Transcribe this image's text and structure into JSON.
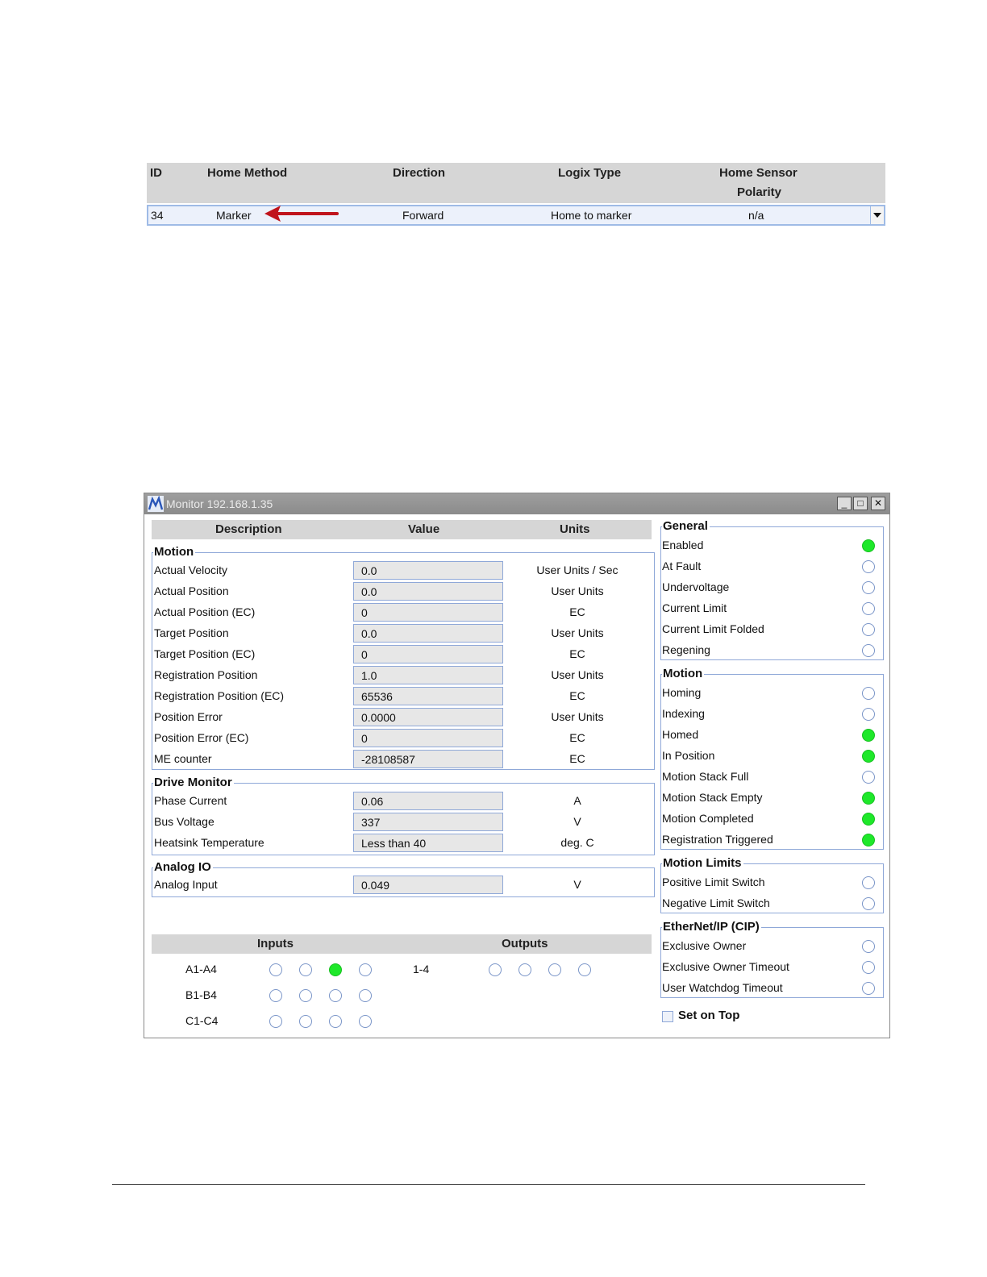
{
  "home_table": {
    "headers": {
      "id": "ID",
      "method": "Home Method",
      "direction": "Direction",
      "logix": "Logix Type",
      "sensor_line1": "Home Sensor",
      "sensor_line2": "Polarity"
    },
    "row": {
      "id": "34",
      "method": "Marker",
      "direction": "Forward",
      "logix": "Home to marker",
      "sensor": "n/a"
    }
  },
  "monitor": {
    "title": "Monitor  192.168.1.35",
    "window_buttons": {
      "minimize": "_",
      "maximize": "□",
      "close": "✕"
    },
    "columns": {
      "description": "Description",
      "value": "Value",
      "units": "Units"
    },
    "motion_group": "Motion",
    "motion_rows": [
      {
        "desc": "Actual Velocity",
        "value": "0.0",
        "unit": "User Units / Sec"
      },
      {
        "desc": "Actual Position",
        "value": "0.0",
        "unit": "User Units"
      },
      {
        "desc": "Actual Position (EC)",
        "value": "0",
        "unit": "EC"
      },
      {
        "desc": "Target Position",
        "value": "0.0",
        "unit": "User Units"
      },
      {
        "desc": "Target Position (EC)",
        "value": "0",
        "unit": "EC"
      },
      {
        "desc": "Registration Position",
        "value": "1.0",
        "unit": "User Units"
      },
      {
        "desc": "Registration Position (EC)",
        "value": "65536",
        "unit": "EC"
      },
      {
        "desc": "Position Error",
        "value": "0.0000",
        "unit": "User Units"
      },
      {
        "desc": "Position Error (EC)",
        "value": "0",
        "unit": "EC"
      },
      {
        "desc": "ME counter",
        "value": "-28108587",
        "unit": "EC"
      }
    ],
    "drive_group": "Drive Monitor",
    "drive_rows": [
      {
        "desc": "Phase Current",
        "value": "0.06",
        "unit": "A"
      },
      {
        "desc": "Bus Voltage",
        "value": "337",
        "unit": "V"
      },
      {
        "desc": "Heatsink Temperature",
        "value": "Less than 40",
        "unit": "deg. C"
      }
    ],
    "analog_group": "Analog IO",
    "analog_rows": [
      {
        "desc": "Analog Input",
        "value": "0.049",
        "unit": "V"
      }
    ],
    "io": {
      "inputs_header": "Inputs",
      "outputs_header": "Outputs",
      "input_rows": [
        {
          "label": "A1-A4",
          "states": [
            false,
            false,
            true,
            false
          ]
        },
        {
          "label": "B1-B4",
          "states": [
            false,
            false,
            false,
            false
          ]
        },
        {
          "label": "C1-C4",
          "states": [
            false,
            false,
            false,
            false
          ]
        }
      ],
      "output_rows": [
        {
          "label": "1-4",
          "states": [
            false,
            false,
            false,
            false
          ]
        }
      ]
    },
    "status_groups": [
      {
        "title": "General",
        "items": [
          {
            "label": "Enabled",
            "on": true
          },
          {
            "label": "At Fault",
            "on": false
          },
          {
            "label": "Undervoltage",
            "on": false
          },
          {
            "label": "Current Limit",
            "on": false
          },
          {
            "label": "Current Limit Folded",
            "on": false
          },
          {
            "label": "Regening",
            "on": false
          }
        ]
      },
      {
        "title": "Motion",
        "items": [
          {
            "label": "Homing",
            "on": false
          },
          {
            "label": "Indexing",
            "on": false
          },
          {
            "label": "Homed",
            "on": true
          },
          {
            "label": "In Position",
            "on": true
          },
          {
            "label": "Motion Stack Full",
            "on": false
          },
          {
            "label": "Motion Stack Empty",
            "on": true
          },
          {
            "label": "Motion Completed",
            "on": true
          },
          {
            "label": "Registration Triggered",
            "on": true
          }
        ]
      },
      {
        "title": "Motion Limits",
        "items": [
          {
            "label": "Positive Limit Switch",
            "on": false
          },
          {
            "label": "Negative Limit Switch",
            "on": false
          }
        ]
      },
      {
        "title": "EtherNet/IP (CIP)",
        "items": [
          {
            "label": "Exclusive Owner",
            "on": false
          },
          {
            "label": "Exclusive Owner Timeout",
            "on": false
          },
          {
            "label": "User Watchdog Timeout",
            "on": false
          }
        ]
      }
    ],
    "set_on_top": {
      "label": "Set on Top",
      "checked": false
    }
  },
  "colors": {
    "led_on": "#1ee82a",
    "led_border": "#7a95c8",
    "header_gray": "#d6d6d6",
    "annotation_arrow": "#c0141c"
  }
}
